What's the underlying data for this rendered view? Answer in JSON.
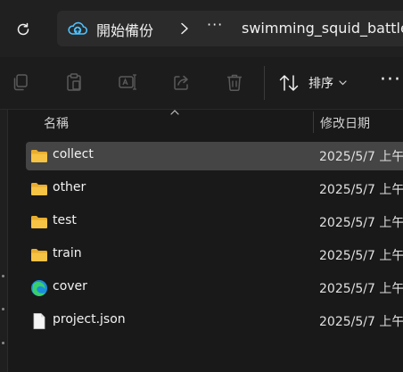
{
  "address": {
    "root_label": "開始備份",
    "overflow_label": "···",
    "current_folder": "swimming_squid_battle"
  },
  "toolbar": {
    "sort_label": "排序",
    "more_label": "···"
  },
  "columns": {
    "name": "名稱",
    "date": "修改日期"
  },
  "files": [
    {
      "name": "collect",
      "date": "2025/5/7 上午",
      "icon": "folder-icon",
      "selected": true
    },
    {
      "name": "other",
      "date": "2025/5/7 上午",
      "icon": "folder-icon",
      "selected": false
    },
    {
      "name": "test",
      "date": "2025/5/7 上午",
      "icon": "folder-icon",
      "selected": false
    },
    {
      "name": "train",
      "date": "2025/5/7 上午",
      "icon": "folder-icon",
      "selected": false
    },
    {
      "name": "cover",
      "date": "2025/5/7 上午",
      "icon": "edge-browser-icon",
      "selected": false
    },
    {
      "name": "project.json",
      "date": "2025/5/7 上午",
      "icon": "document-file-icon",
      "selected": false
    }
  ],
  "colors": {
    "background": "#191919",
    "selection": "#454545",
    "folder": "#f6c344",
    "accent": "#4cc2ff"
  }
}
